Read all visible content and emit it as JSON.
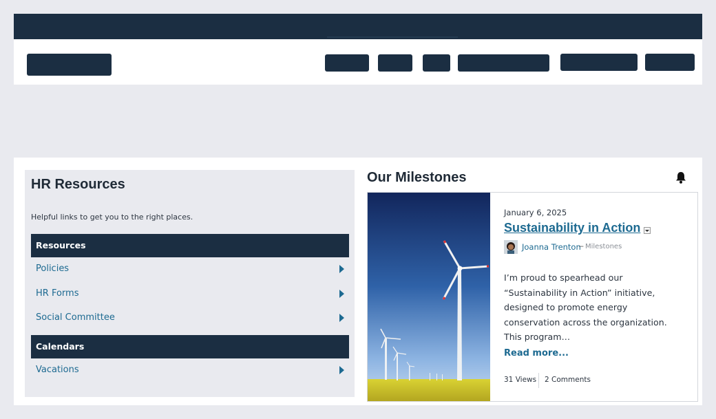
{
  "hr": {
    "title": "HR Resources",
    "description": "Helpful links to get you to the right places.",
    "sections": [
      {
        "heading": "Resources",
        "items": [
          "Policies",
          "HR Forms",
          "Social Committee"
        ]
      },
      {
        "heading": "Calendars",
        "items": [
          "Vacations"
        ]
      }
    ]
  },
  "milestones": {
    "title": "Our Milestones",
    "post": {
      "date": "January 6, 2025",
      "title": "Sustainability in Action",
      "author": "Joanna Trenton",
      "separator": "–",
      "category": "Milestones",
      "excerpt": "I’m proud to spearhead our “Sustainability in Action” initiative, designed to promote energy conservation across the organization. This program…",
      "read_more": "Read more...",
      "views": "31 Views",
      "comments": "2 Comments"
    }
  },
  "icons": {
    "notification": "bell-icon",
    "link_arrow": "caret-right-icon",
    "post_menu": "dropdown-icon"
  },
  "colors": {
    "dark_navy": "#1b2e42",
    "link_blue": "#1d6a91",
    "page_bg": "#e9eaef"
  }
}
